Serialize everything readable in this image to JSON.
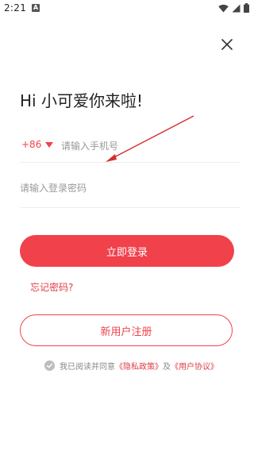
{
  "status_bar": {
    "time": "2:21",
    "notification_badge": "A"
  },
  "close": {
    "icon": "close-icon"
  },
  "greeting": "Hi 小可爱你来啦!",
  "phone": {
    "country_code": "+86",
    "placeholder": "请输入手机号"
  },
  "password": {
    "placeholder": "请输入登录密码"
  },
  "login_button": "立即登录",
  "forgot_password": "忘记密码?",
  "register_button": "新用户注册",
  "agreement": {
    "prefix": "我已阅读并同意",
    "privacy_link": "《隐私政策》",
    "conjunction": "及",
    "terms_link": "《用户协议》"
  },
  "colors": {
    "accent": "#f1414b",
    "link": "#e03c44",
    "placeholder": "#999999"
  }
}
